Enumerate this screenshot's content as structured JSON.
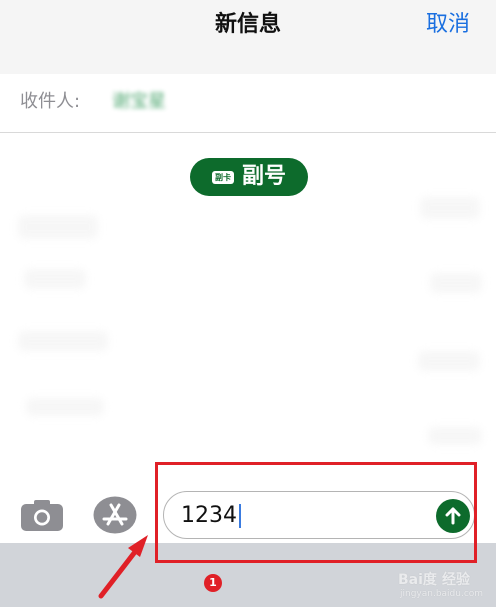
{
  "header": {
    "title": "新信息",
    "cancel_label": "取消"
  },
  "recipient": {
    "label": "收件人:",
    "value": "谢宝星"
  },
  "sim_chip": {
    "icon_text": "副卡",
    "label": "副号"
  },
  "composer": {
    "message_text": "1234"
  },
  "annotation": {
    "step_number": "1"
  },
  "watermark": {
    "brand": "Bai度",
    "cn": "经验",
    "url": "jingyan.baidu.com"
  },
  "colors": {
    "accent_blue": "#1a6fe0",
    "accent_green": "#0d6b2c",
    "highlight_red": "#e02027",
    "keyboard_gray": "#d1d4d9"
  },
  "icons": {
    "camera": "camera-icon",
    "appstore": "appstore-icon",
    "send": "send-arrow-icon",
    "sim": "sim-card-icon"
  }
}
